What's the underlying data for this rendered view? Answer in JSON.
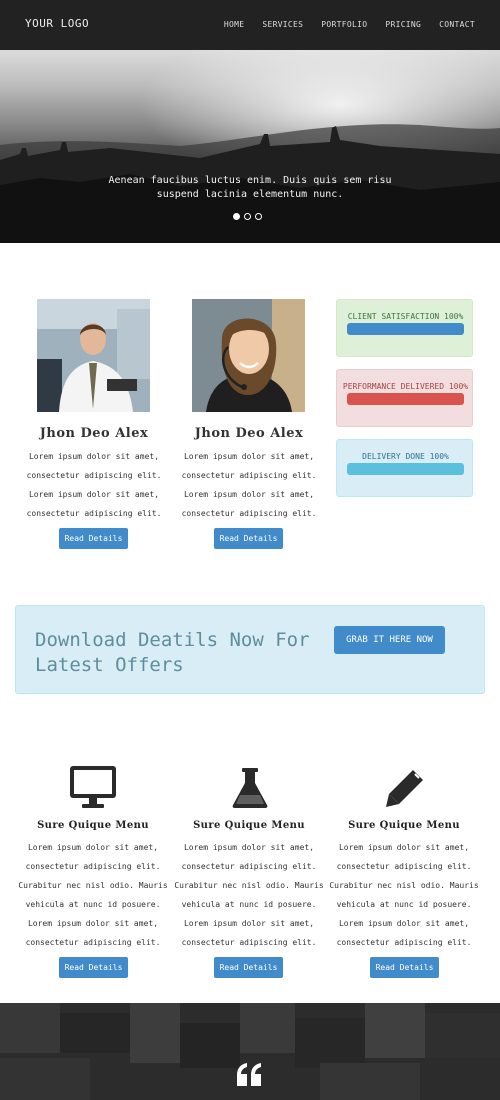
{
  "nav": {
    "logo": "YOUR LOGO",
    "items": [
      "HOME",
      "SERVICES",
      "PORTFOLIO",
      "PRICING",
      "CONTACT"
    ]
  },
  "hero": {
    "caption": "Aenean faucibus luctus enim. Duis quis sem risu suspend lacinia elementum nunc.",
    "slides": 3,
    "active_slide": 1
  },
  "team": [
    {
      "name": "Jhon Deo Alex",
      "desc": "Lorem ipsum dolor sit amet, consectetur adipiscing elit. Lorem ipsum dolor sit amet, consectetur adipiscing elit.",
      "button": "Read Details"
    },
    {
      "name": "Jhon Deo Alex",
      "desc": "Lorem ipsum dolor sit amet, consectetur adipiscing elit. Lorem ipsum dolor sit amet, consectetur adipiscing elit.",
      "button": "Read Details"
    }
  ],
  "stats": [
    {
      "label": "CLIENT SATISFACTION 100%",
      "progress": 1.0,
      "bg": "#dff0d8",
      "border": "#d6e9c6",
      "bar": "#428bca",
      "text": "#3c763d"
    },
    {
      "label": "PERFORMANCE DELIVERED 100%",
      "progress": 1.0,
      "bg": "#f2dede",
      "border": "#ebccd1",
      "bar": "#d9534f",
      "text": "#a94442"
    },
    {
      "label": "DELIVERY DONE 100%",
      "progress": 1.0,
      "bg": "#d9edf7",
      "border": "#bce8f1",
      "bar": "#5bc0de",
      "text": "#31708f"
    }
  ],
  "cta": {
    "title": "Download Deatils Now For Latest Offers",
    "button": "GRAB IT HERE NOW"
  },
  "features": [
    {
      "icon": "monitor-icon",
      "title": "Sure Quique Menu",
      "desc": "Lorem ipsum dolor sit amet, consectetur adipiscing elit. Curabitur nec nisl odio. Mauris vehicula at nunc id posuere. Lorem ipsum dolor sit amet, consectetur adipiscing elit.",
      "button": "Read Details"
    },
    {
      "icon": "flask-icon",
      "title": "Sure Quique Menu",
      "desc": "Lorem ipsum dolor sit amet, consectetur adipiscing elit. Curabitur nec nisl odio. Mauris vehicula at nunc id posuere. Lorem ipsum dolor sit amet, consectetur adipiscing elit.",
      "button": "Read Details"
    },
    {
      "icon": "pencil-icon",
      "title": "Sure Quique Menu",
      "desc": "Lorem ipsum dolor sit amet, consectetur adipiscing elit. Curabitur nec nisl odio. Mauris vehicula at nunc id posuere. Lorem ipsum dolor sit amet, consectetur adipiscing elit.",
      "button": "Read Details"
    }
  ],
  "testimonial": {
    "icon": "quote-icon"
  },
  "colors": {
    "primary": "#428bca",
    "dark": "#222222"
  }
}
